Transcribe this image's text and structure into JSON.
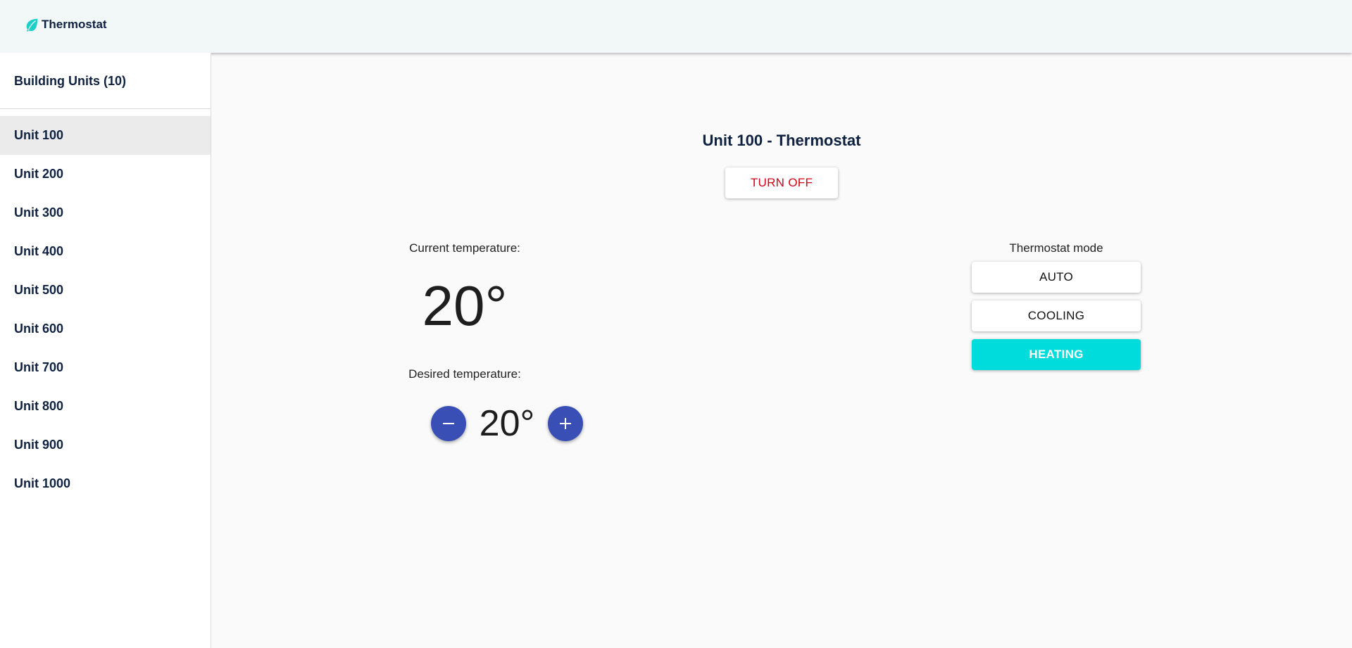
{
  "app": {
    "title": "Thermostat",
    "icon": "leaf-icon",
    "accent_color": "#1ccfc9"
  },
  "sidebar": {
    "header": "Building Units (10)",
    "items": [
      {
        "label": "Unit 100",
        "selected": true
      },
      {
        "label": "Unit 200",
        "selected": false
      },
      {
        "label": "Unit 300",
        "selected": false
      },
      {
        "label": "Unit 400",
        "selected": false
      },
      {
        "label": "Unit 500",
        "selected": false
      },
      {
        "label": "Unit 600",
        "selected": false
      },
      {
        "label": "Unit 700",
        "selected": false
      },
      {
        "label": "Unit 800",
        "selected": false
      },
      {
        "label": "Unit 900",
        "selected": false
      },
      {
        "label": "Unit 1000",
        "selected": false
      }
    ]
  },
  "main": {
    "title": "Unit 100 - Thermostat",
    "power_button_label": "TURN OFF",
    "power_button_color": "#d0021b",
    "current_label": "Current temperature:",
    "current_temp": "20°",
    "desired_label": "Desired temperature:",
    "desired_temp": "20°",
    "decrease_icon": "minus-icon",
    "increase_icon": "plus-icon",
    "stepper_color": "#3a4fb5",
    "mode": {
      "label": "Thermostat mode",
      "options": [
        "AUTO",
        "COOLING",
        "HEATING"
      ],
      "selected": "HEATING",
      "selected_color": "#00dcdc"
    }
  }
}
